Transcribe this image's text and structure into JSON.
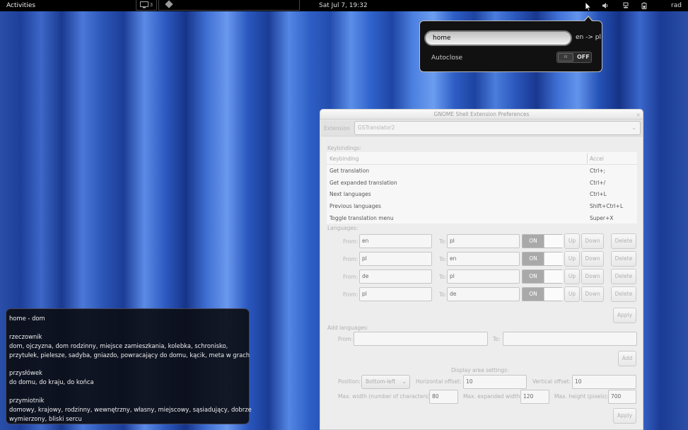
{
  "topbar": {
    "activities": "Activities",
    "workspace_count": "3",
    "clock": "Sat Jul  7, 19:32",
    "user": "rad"
  },
  "translator_popup": {
    "query": "home",
    "lang_pair": "en -> pl",
    "autoclose_label": "Autoclose",
    "autoclose_state": "OFF",
    "autoclose_knob": "III"
  },
  "result": {
    "lines": [
      "home - dom",
      "",
      "rzeczownik",
      "dom, ojczyzna, dom rodzinny, miejsce zamieszkania, kolebka, schronisko,",
      "przytułek, pielesze, sadyba, gniazdo, powracający do domu, kącik, meta w grach",
      "",
      "przysłówek",
      "do domu, do kraju, do końca",
      "",
      "przymiotnik",
      "domowy, krajowy, rodzinny, wewnętrzny, własny, miejscowy, sąsiadujący, dobrze",
      "wymierzony, bliski sercu"
    ]
  },
  "prefs": {
    "title": "GNOME Shell Extension Preferences",
    "close": "×",
    "extension_label": "Extension",
    "extension_value": "GSTranslator2",
    "keybindings_label": "Keybindings:",
    "kb_col1": "Keybinding",
    "kb_col2": "Accel",
    "keybindings": [
      {
        "name": "Get translation",
        "accel": "Ctrl+;"
      },
      {
        "name": "Get expanded translation",
        "accel": "Ctrl+/"
      },
      {
        "name": "Next languages",
        "accel": "Ctrl+L"
      },
      {
        "name": "Previous languages",
        "accel": "Shift+Ctrl+L"
      },
      {
        "name": "Toggle translation menu",
        "accel": "Super+X"
      }
    ],
    "languages_label": "Languages:",
    "from_label": "From:",
    "to_label": "To:",
    "on_label": "ON",
    "up_label": "Up",
    "down_label": "Down",
    "delete_label": "Delete",
    "languages": [
      {
        "from": "en",
        "to": "pl"
      },
      {
        "from": "pl",
        "to": "en"
      },
      {
        "from": "de",
        "to": "pl"
      },
      {
        "from": "pl",
        "to": "de"
      }
    ],
    "apply_label": "Apply",
    "add_languages_label": "Add languages:",
    "add_from_label": "From:",
    "add_to_label": "To:",
    "add_label": "Add",
    "display_label": "Display area settings:",
    "position_label": "Position:",
    "position_value": "Bottom-left",
    "h_offset_label": "Horizontal offset:",
    "h_offset_value": "10",
    "v_offset_label": "Vertical offset:",
    "v_offset_value": "10",
    "max_width_label": "Max. width (number of characters):",
    "max_width_value": "80",
    "max_exp_width_label": "Max. expanded width:",
    "max_exp_width_value": "120",
    "max_height_label": "Max. height (pixels):",
    "max_height_value": "700",
    "apply2_label": "Apply"
  }
}
